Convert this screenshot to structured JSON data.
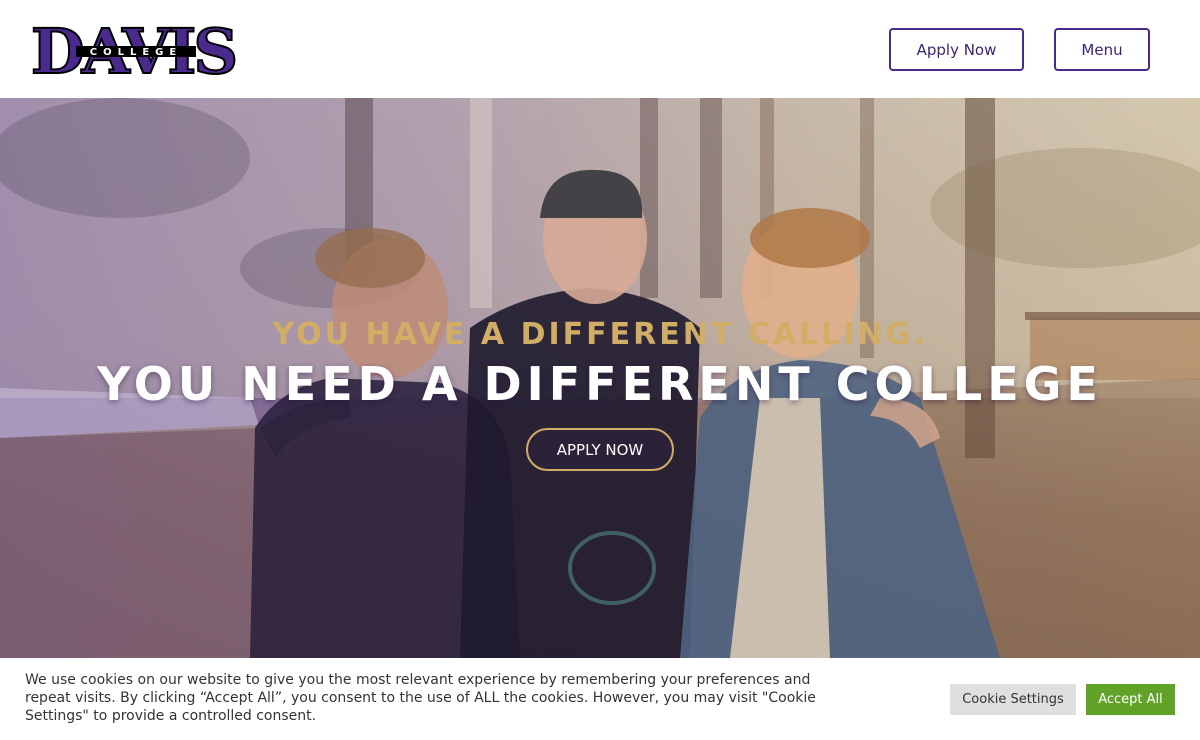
{
  "header": {
    "logo": {
      "main": "DAVIS",
      "sub": "COLLEGE",
      "alt": "Davis College"
    },
    "apply_label": "Apply Now",
    "menu_label": "Menu"
  },
  "hero": {
    "subtitle": "YOU HAVE A DIFFERENT CALLING.",
    "title": "YOU NEED A DIFFERENT COLLEGE",
    "cta_label": "APPLY NOW",
    "image_alt": "Three students smiling outdoors among trees"
  },
  "cookie": {
    "text": "We use cookies on our website to give you the most relevant experience by remembering your preferences and repeat visits. By clicking “Accept All”, you consent to the use of ALL the cookies. However, you may visit \"Cookie Settings\" to provide a controlled consent.",
    "settings_label": "Cookie Settings",
    "accept_label": "Accept All"
  },
  "colors": {
    "brand_purple": "#4a2a8c",
    "gold": "#d1ad66",
    "accept_green": "#61a229",
    "settings_gray": "#dedfe0"
  }
}
